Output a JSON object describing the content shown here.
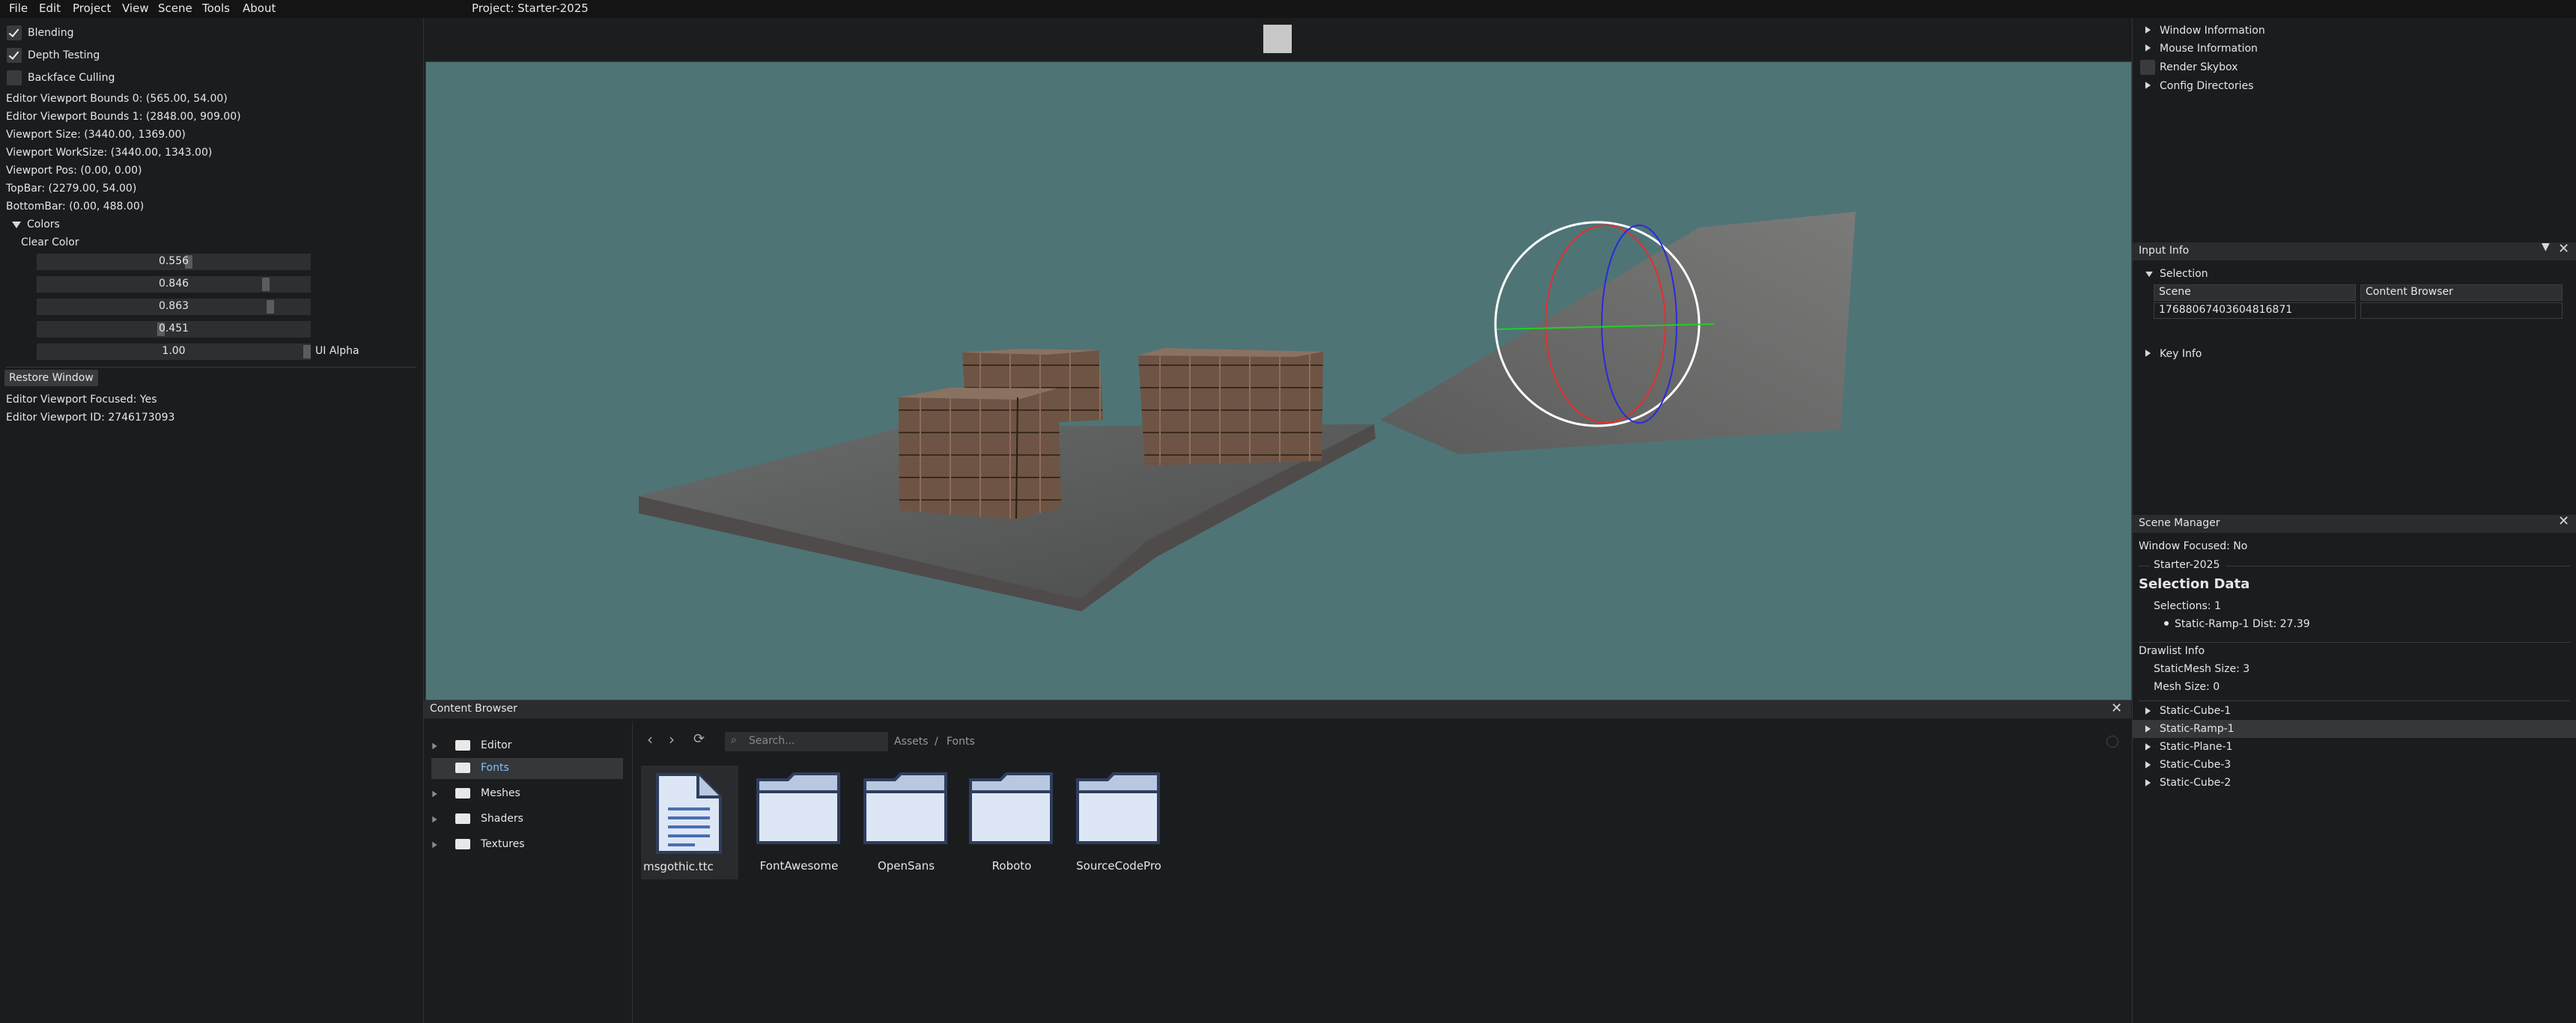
{
  "menu": [
    "File",
    "Edit",
    "Project",
    "View",
    "Scene",
    "Tools",
    "About"
  ],
  "project_title": "Project: Starter-2025",
  "left_panel": {
    "blending": "Blending",
    "depth_testing": "Depth Testing",
    "backface_culling": "Backface Culling",
    "stats": [
      "Editor Viewport Bounds 0: (565.00, 54.00)",
      "Editor Viewport Bounds 1: (2848.00, 909.00)",
      "Viewport Size: (3440.00, 1369.00)",
      "Viewport WorkSize: (3440.00, 1343.00)",
      "Viewport Pos: (0.00, 0.00)",
      "TopBar: (2279.00, 54.00)",
      "BottomBar: (0.00, 488.00)"
    ],
    "colors_label": "Colors",
    "clear_color_label": "Clear Color",
    "sliders": [
      {
        "value": "0.556",
        "level": 0.556
      },
      {
        "value": "0.846",
        "level": 0.846
      },
      {
        "value": "0.863",
        "level": 0.863
      },
      {
        "value": "0.451",
        "level": 0.451
      }
    ],
    "ui_alpha": {
      "value": "1.00",
      "label": "UI Alpha",
      "level": 1.0
    },
    "restore_window": "Restore Window",
    "focused": "Editor Viewport Focused: Yes",
    "viewport_id": "Editor Viewport ID: 2746173093"
  },
  "right_panel": {
    "window_information": "Window Information",
    "mouse_information": "Mouse Information",
    "render_skybox": "Render Skybox",
    "config_directories": "Config Directories",
    "input_info_title": "Input Info",
    "selection": "Selection",
    "table_headers": [
      "Scene",
      "Content Browser"
    ],
    "table_values": [
      "17688067403604816871",
      ""
    ],
    "key_info": "Key Info",
    "scene_manager_title": "Scene Manager",
    "window_focused": "Window Focused: No",
    "scene_name": "Starter-2025",
    "selection_data": "Selection Data",
    "selections": "Selections: 1",
    "selected_item": "Static-Ramp-1  Dist: 27.39",
    "drawlist_info": "Drawlist Info",
    "staticmesh_size": "StaticMesh Size:  3",
    "mesh_size": "Mesh Size:      0",
    "scene_items": [
      "Static-Cube-1",
      "Static-Ramp-1",
      "Static-Plane-1",
      "Static-Cube-3",
      "Static-Cube-2"
    ]
  },
  "content_browser": {
    "title": "Content Browser",
    "folders": [
      "Editor",
      "Fonts",
      "Meshes",
      "Shaders",
      "Textures"
    ],
    "search_placeholder": "Search...",
    "breadcrumb": [
      "Assets",
      "/",
      "Fonts"
    ],
    "items": [
      "msgothic.ttc",
      "FontAwesome",
      "OpenSans",
      "Roboto",
      "SourceCodePro"
    ]
  }
}
